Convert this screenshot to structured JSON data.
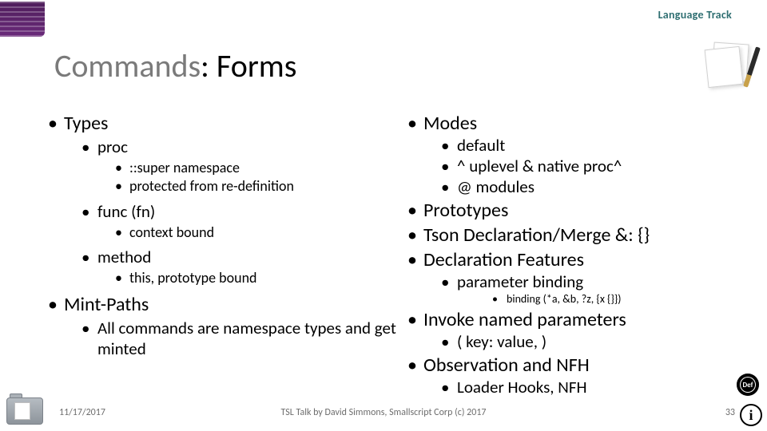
{
  "header": {
    "track_label": "Language Track",
    "title_light": "Commands",
    "title_sep": ": ",
    "title_dark": "Forms"
  },
  "left": {
    "types": {
      "label": "Types",
      "proc": {
        "label": "proc",
        "items": [
          "::super namespace",
          "protected from re-definition"
        ]
      },
      "func": {
        "label": "func (fn)",
        "items": [
          "context bound"
        ]
      },
      "method": {
        "label": "method",
        "items": [
          "this, prototype bound"
        ]
      }
    },
    "mint": {
      "label": "Mint-Paths",
      "items": [
        "All commands are namespace types and get minted"
      ]
    }
  },
  "right": {
    "modes": {
      "label": "Modes",
      "items": [
        "default",
        "^ uplevel & native proc^",
        "@ modules"
      ]
    },
    "prototypes": "Prototypes",
    "tson": "Tson Declaration/Merge &: {}",
    "declfeat": {
      "label": "Declaration Features",
      "param_binding": "parameter binding",
      "binding_detail": "binding (*a, &b, ?z, {x {}})"
    },
    "invoke": {
      "label": "Invoke named parameters",
      "item": "( key: value, )"
    },
    "observation": {
      "label": "Observation and NFH",
      "item": "Loader Hooks, NFH"
    }
  },
  "footer": {
    "date": "11/17/2017",
    "center": "TSL Talk by David Simmons, Smallscript Corp (c) 2017",
    "page": "33"
  },
  "badges": {
    "def": "Def",
    "info": "i"
  }
}
